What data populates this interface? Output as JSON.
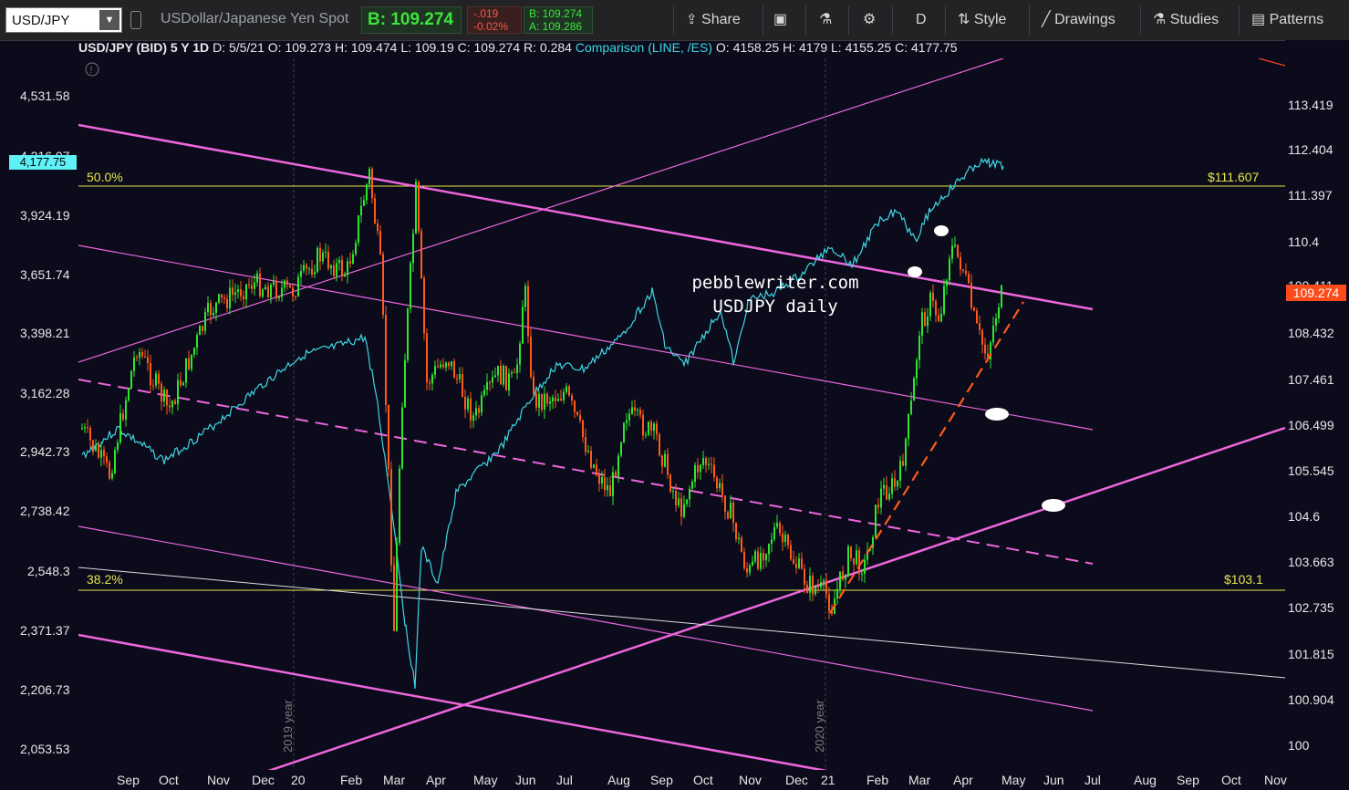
{
  "toolbar": {
    "symbol": "USD/JPY",
    "description": "USDollar/Japanese Yen Spot",
    "bid_label": "B: 109.274",
    "change": "-.019",
    "change_pct": "-0.02%",
    "bid_small": "B: 109.274",
    "ask_small": "A: 109.286",
    "share": "Share",
    "aggregation": "D",
    "style": "Style",
    "drawings": "Drawings",
    "studies": "Studies",
    "patterns": "Patterns"
  },
  "info_bar": {
    "title": "USD/JPY (BID) 5 Y 1D",
    "date": "D: 5/5/21",
    "open": "O: 109.273",
    "high": "H: 109.474",
    "low": "L: 109.19",
    "close": "C: 109.274",
    "range": "R: 0.284",
    "comparison": "Comparison (LINE, /ES)",
    "cmp_open": "O: 4158.25",
    "cmp_high": "H: 4179",
    "cmp_low": "L: 4155.25",
    "cmp_close": "C: 4177.75"
  },
  "watermark": {
    "line1": "pebblewriter.com",
    "line2": "USDJPY daily"
  },
  "fib_labels": {
    "top_pct": "50.0%",
    "top_price": "$111.607",
    "bot_pct": "38.2%",
    "bot_price": "$103.1"
  },
  "year_labels": [
    "2019 year",
    "2020 year"
  ],
  "badges": {
    "cyan": "4,177.75",
    "red": "109.274"
  },
  "chart_data": {
    "type": "line",
    "title": "USD/JPY (BID) 5 Y 1D",
    "left_axis_ticks": [
      "4,531.58",
      "4,216.07",
      "3,924.19",
      "3,651.74",
      "3,398.21",
      "3,162.28",
      "2,942.73",
      "2,738.42",
      "2,548.3",
      "2,371.37",
      "2,206.73",
      "2,053.53"
    ],
    "right_axis_ticks": [
      "113.419",
      "112.404",
      "111.397",
      "110.4",
      "109.411",
      "108.432",
      "107.461",
      "106.499",
      "105.545",
      "104.6",
      "103.663",
      "102.735",
      "101.815",
      "100.904",
      "100"
    ],
    "x_ticks": [
      "Sep",
      "Oct",
      "Nov",
      "Dec",
      "20",
      "Feb",
      "Mar",
      "Apr",
      "May",
      "Jun",
      "Jul",
      "Aug",
      "Sep",
      "Oct",
      "Nov",
      "Dec",
      "21",
      "Feb",
      "Mar",
      "Apr",
      "May",
      "Jun",
      "Jul",
      "Aug",
      "Sep",
      "Oct",
      "Nov"
    ],
    "usdjpy_close_approx": [
      {
        "x": "2019-09",
        "y": 106.9
      },
      {
        "x": "2019-10",
        "y": 108.1
      },
      {
        "x": "2019-11",
        "y": 108.8
      },
      {
        "x": "2019-12",
        "y": 109.5
      },
      {
        "x": "2020-01",
        "y": 109.3
      },
      {
        "x": "2020-02",
        "y": 110.3
      },
      {
        "x": "2020-03",
        "y": 104.5
      },
      {
        "x": "2020-03-24",
        "y": 111.3
      },
      {
        "x": "2020-04",
        "y": 107.3
      },
      {
        "x": "2020-05",
        "y": 107.5
      },
      {
        "x": "2020-06",
        "y": 107.7
      },
      {
        "x": "2020-07",
        "y": 105.8
      },
      {
        "x": "2020-08",
        "y": 105.9
      },
      {
        "x": "2020-09",
        "y": 105.5
      },
      {
        "x": "2020-10",
        "y": 104.6
      },
      {
        "x": "2020-11",
        "y": 104.2
      },
      {
        "x": "2020-12",
        "y": 103.3
      },
      {
        "x": "2021-01",
        "y": 103.0
      },
      {
        "x": "2021-02",
        "y": 105.5
      },
      {
        "x": "2021-03",
        "y": 109.0
      },
      {
        "x": "2021-04",
        "y": 108.0
      },
      {
        "x": "2021-05-05",
        "y": 109.274
      }
    ],
    "comparison_es_approx": [
      {
        "x": "2019-09",
        "y": 2980
      },
      {
        "x": "2019-10",
        "y": 3030
      },
      {
        "x": "2019-11",
        "y": 3140
      },
      {
        "x": "2019-12",
        "y": 3230
      },
      {
        "x": "2020-01",
        "y": 3280
      },
      {
        "x": "2020-02",
        "y": 3370
      },
      {
        "x": "2020-03",
        "y": 2300
      },
      {
        "x": "2020-04",
        "y": 2830
      },
      {
        "x": "2020-05",
        "y": 2950
      },
      {
        "x": "2020-06",
        "y": 3100
      },
      {
        "x": "2020-07",
        "y": 3250
      },
      {
        "x": "2020-08",
        "y": 3480
      },
      {
        "x": "2020-09",
        "y": 3350
      },
      {
        "x": "2020-10",
        "y": 3300
      },
      {
        "x": "2020-11",
        "y": 3600
      },
      {
        "x": "2020-12",
        "y": 3720
      },
      {
        "x": "2021-01",
        "y": 3780
      },
      {
        "x": "2021-02",
        "y": 3830
      },
      {
        "x": "2021-03",
        "y": 3960
      },
      {
        "x": "2021-04",
        "y": 4150
      },
      {
        "x": "2021-05-05",
        "y": 4177.75
      }
    ]
  },
  "colors": {
    "background": "#0b0b1c",
    "up": "#2ee62e",
    "down": "#ff5a1a",
    "comparison": "#3fd7e3",
    "channel": "#ee66dd",
    "fib": "#e6e64a"
  }
}
